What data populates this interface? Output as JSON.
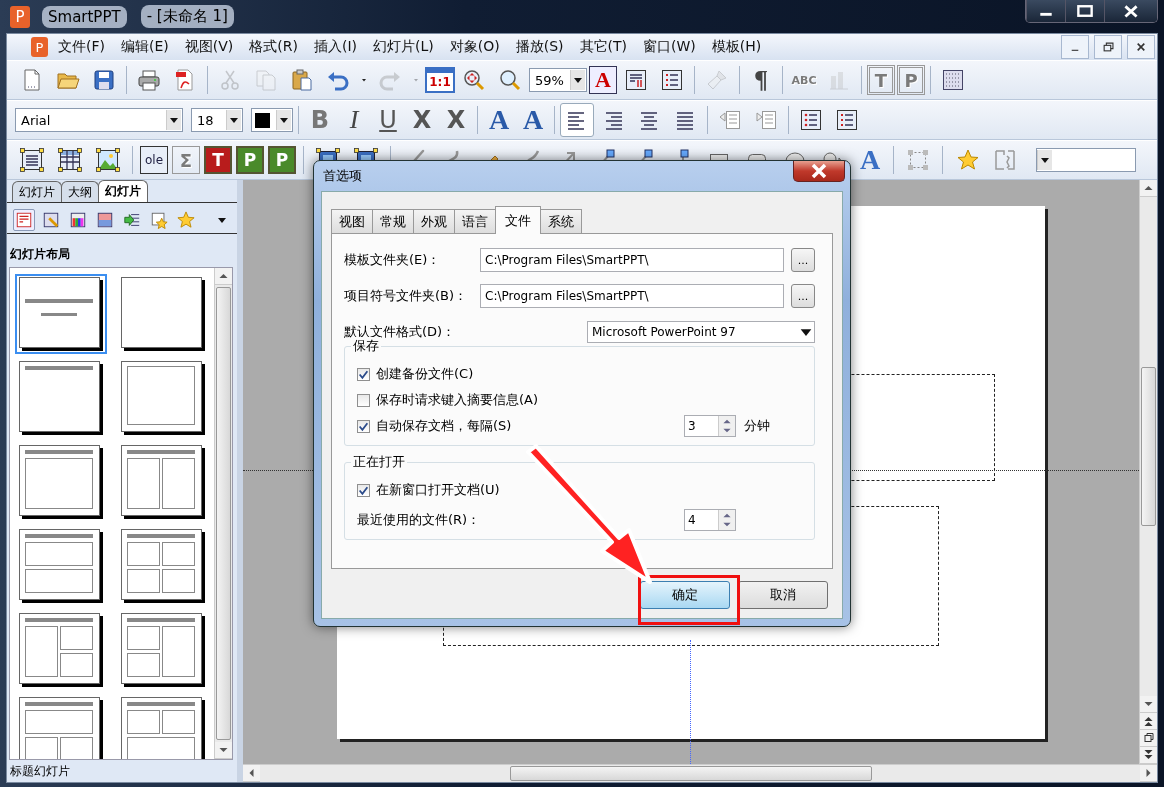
{
  "window": {
    "logo": "P",
    "title": "SmartPPT",
    "document": "- [未命名 1]"
  },
  "menubar": {
    "logo": "P",
    "items": [
      "文件(F)",
      "编辑(E)",
      "视图(V)",
      "格式(R)",
      "插入(I)",
      "幻灯片(L)",
      "对象(O)",
      "播放(S)",
      "其它(T)",
      "窗口(W)",
      "模板(H)"
    ]
  },
  "toolbars": [
    {
      "items": [
        {
          "kind": "new",
          "disabled": false
        },
        {
          "kind": "open",
          "disabled": false
        },
        {
          "kind": "save",
          "disabled": false
        },
        {
          "kind": "separator"
        },
        {
          "kind": "print",
          "disabled": false
        },
        {
          "kind": "pdf",
          "disabled": false
        },
        {
          "kind": "separator"
        },
        {
          "kind": "cut",
          "disabled": true
        },
        {
          "kind": "copy",
          "disabled": true
        },
        {
          "kind": "paste",
          "disabled": false
        },
        {
          "kind": "undo",
          "disabled": false
        },
        {
          "kind": "redo",
          "disabled": true
        },
        {
          "kind": "ratio",
          "glyph": "1:1",
          "disabled": false
        },
        {
          "kind": "zoom-pan",
          "disabled": false
        },
        {
          "kind": "zoom",
          "disabled": false
        },
        {
          "kind": "zoom-select",
          "value": "59%",
          "disabled": false
        },
        {
          "kind": "text-color",
          "glyph": "A",
          "disabled": false
        },
        {
          "kind": "paragraph",
          "disabled": false
        },
        {
          "kind": "numbering",
          "disabled": false
        },
        {
          "kind": "separator"
        },
        {
          "kind": "brush",
          "disabled": true
        },
        {
          "kind": "separator"
        },
        {
          "kind": "pilcrow",
          "glyph": "¶",
          "disabled": false
        },
        {
          "kind": "separator"
        },
        {
          "kind": "spell",
          "glyph": "ABC",
          "disabled": true
        },
        {
          "kind": "chart",
          "disabled": true
        },
        {
          "kind": "separator"
        },
        {
          "kind": "template",
          "glyph": "T",
          "disabled": true
        },
        {
          "kind": "template",
          "glyph": "P",
          "disabled": true
        },
        {
          "kind": "separator"
        },
        {
          "kind": "grid",
          "disabled": false
        }
      ]
    },
    {
      "items": [
        {
          "kind": "font-select",
          "value": "Arial",
          "disabled": false
        },
        {
          "kind": "size-select",
          "value": "18",
          "disabled": false
        },
        {
          "kind": "color-select",
          "color": "#000000",
          "disabled": false
        },
        {
          "kind": "separator"
        },
        {
          "kind": "bold",
          "glyph": "B",
          "disabled": false
        },
        {
          "kind": "italic",
          "glyph": "I",
          "disabled": false
        },
        {
          "kind": "underline",
          "glyph": "U",
          "disabled": false
        },
        {
          "kind": "strike",
          "glyph": "X",
          "disabled": false
        },
        {
          "kind": "strike-double",
          "glyph": "X",
          "disabled": false
        },
        {
          "kind": "separator"
        },
        {
          "kind": "grow",
          "glyph": "A",
          "disabled": false
        },
        {
          "kind": "shrink",
          "glyph": "A",
          "disabled": false
        },
        {
          "kind": "separator"
        },
        {
          "kind": "align-group",
          "items": [
            {
              "kind": "align-left",
              "selected": true
            },
            {
              "kind": "align-right",
              "selected": false
            },
            {
              "kind": "align-center",
              "selected": false
            },
            {
              "kind": "align-justify",
              "selected": false
            }
          ]
        },
        {
          "kind": "separator"
        },
        {
          "kind": "outdent",
          "disabled": false
        },
        {
          "kind": "indent",
          "disabled": false
        },
        {
          "kind": "separator"
        },
        {
          "kind": "bullets",
          "disabled": false
        },
        {
          "kind": "numbering",
          "disabled": false
        }
      ]
    },
    {
      "items": [
        {
          "kind": "textbox",
          "disabled": false
        },
        {
          "kind": "table",
          "disabled": false
        },
        {
          "kind": "image",
          "disabled": false
        },
        {
          "kind": "separator"
        },
        {
          "kind": "ole",
          "glyph": "ole",
          "disabled": false
        },
        {
          "kind": "formula",
          "glyph": "Σ",
          "disabled": true
        },
        {
          "kind": "frame-red",
          "glyph": "T",
          "disabled": false
        },
        {
          "kind": "frame-green",
          "glyph": "P",
          "disabled": false
        },
        {
          "kind": "frame-green",
          "glyph": "P",
          "disabled": false
        },
        {
          "kind": "separator"
        },
        {
          "kind": "media",
          "disabled": false
        },
        {
          "kind": "media",
          "disabled": false
        },
        {
          "kind": "separator"
        },
        {
          "kind": "line",
          "disabled": false
        },
        {
          "kind": "curve",
          "disabled": false
        },
        {
          "kind": "scribble",
          "disabled": false
        },
        {
          "kind": "s-curve",
          "disabled": false
        },
        {
          "kind": "arrow",
          "disabled": false
        },
        {
          "kind": "connector",
          "disabled": false
        },
        {
          "kind": "connector",
          "disabled": false
        },
        {
          "kind": "elbow",
          "disabled": false
        },
        {
          "kind": "rect",
          "disabled": false
        },
        {
          "kind": "roundrect",
          "disabled": false
        },
        {
          "kind": "ellipse",
          "disabled": false
        },
        {
          "kind": "shape",
          "disabled": false
        },
        {
          "kind": "wordart",
          "glyph": "A",
          "disabled": false
        },
        {
          "kind": "separator"
        },
        {
          "kind": "group",
          "disabled": false
        },
        {
          "kind": "separator"
        },
        {
          "kind": "star",
          "disabled": false
        },
        {
          "kind": "wrench",
          "disabled": false
        },
        {
          "kind": "style-select",
          "disabled": false
        }
      ]
    }
  ],
  "side_panel": {
    "tabs": [
      {
        "label": "幻灯片",
        "selected": false
      },
      {
        "label": "大纲",
        "selected": false
      },
      {
        "label": "幻灯片",
        "selected": true
      }
    ],
    "heading": "幻灯片布局",
    "layouts": [
      {
        "kind": "title",
        "selected": true
      },
      {
        "kind": "blank",
        "selected": false
      },
      {
        "kind": "title-only",
        "selected": false
      },
      {
        "kind": "frame",
        "selected": false
      },
      {
        "kind": "title-content",
        "selected": false
      },
      {
        "kind": "two-columns",
        "selected": false
      },
      {
        "kind": "two-rows",
        "selected": false
      },
      {
        "kind": "four",
        "selected": false
      },
      {
        "kind": "left-big",
        "selected": false
      },
      {
        "kind": "right-big",
        "selected": false
      },
      {
        "kind": "top-wide",
        "selected": false
      },
      {
        "kind": "top-two",
        "selected": false
      }
    ],
    "status": "标题幻灯片"
  },
  "dialog": {
    "title": "首选项",
    "tabs": [
      {
        "label": "视图",
        "selected": false
      },
      {
        "label": "常规",
        "selected": false
      },
      {
        "label": "外观",
        "selected": false
      },
      {
        "label": "语言",
        "selected": false
      },
      {
        "label": "文件",
        "selected": true
      },
      {
        "label": "系统",
        "selected": false
      }
    ],
    "paths": [
      {
        "label": "模板文件夹(E)：",
        "value": "C:\\Program Files\\SmartPPT\\",
        "button": "..."
      },
      {
        "label": "项目符号文件夹(B)：",
        "value": "C:\\Program Files\\SmartPPT\\",
        "button": "..."
      }
    ],
    "format": {
      "label": "默认文件格式(D)：",
      "value": "Microsoft PowerPoint 97"
    },
    "save_group": {
      "title": "保存",
      "options": [
        {
          "label": "创建备份文件(C)",
          "checked": true
        },
        {
          "label": "保存时请求键入摘要信息(A)",
          "checked": false
        },
        {
          "label": "自动保存文档，每隔(S)",
          "checked": true,
          "spin": "3",
          "unit": "分钟"
        }
      ]
    },
    "open_group": {
      "title": "正在打开",
      "options": [
        {
          "label": "在新窗口打开文档(U)",
          "checked": true
        }
      ],
      "recent": {
        "label": "最近使用的文件(R)：",
        "spin": "4"
      }
    },
    "buttons": [
      {
        "label": "确定",
        "default": true
      },
      {
        "label": "取消",
        "default": false
      }
    ]
  }
}
